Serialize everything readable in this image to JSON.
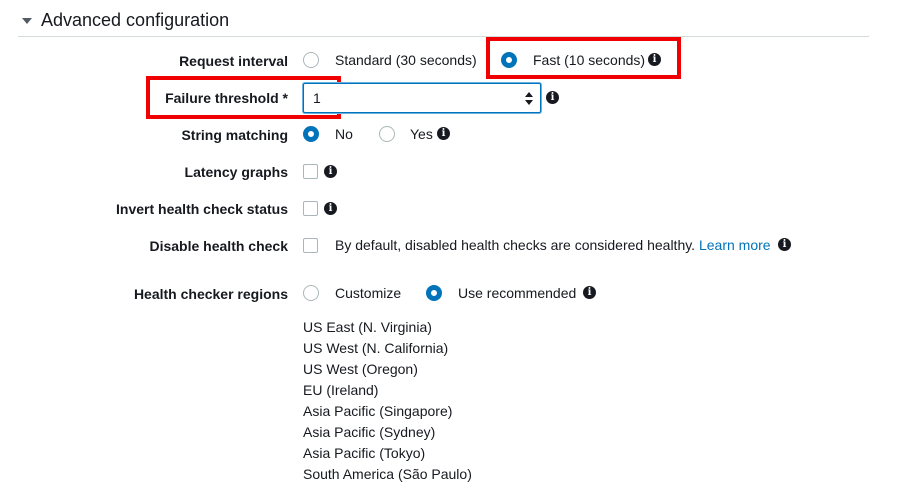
{
  "section": {
    "title": "Advanced configuration",
    "caret_icon": "caret-down-icon"
  },
  "request_interval": {
    "label": "Request interval",
    "options": [
      {
        "label": "Standard (30 seconds)",
        "checked": false
      },
      {
        "label": "Fast (10 seconds)",
        "checked": true
      }
    ]
  },
  "failure_threshold": {
    "label": "Failure threshold *",
    "value": "1"
  },
  "string_matching": {
    "label": "String matching",
    "options": [
      {
        "label": "No",
        "checked": true
      },
      {
        "label": "Yes",
        "checked": false
      }
    ]
  },
  "latency_graphs": {
    "label": "Latency graphs",
    "checked": false
  },
  "invert_status": {
    "label": "Invert health check status",
    "checked": false
  },
  "disable_check": {
    "label": "Disable health check",
    "checked": false,
    "description": "By default, disabled health checks are considered healthy.",
    "learn_more": "Learn more"
  },
  "regions": {
    "label": "Health checker regions",
    "options": [
      {
        "label": "Customize",
        "checked": false
      },
      {
        "label": "Use recommended",
        "checked": true
      }
    ],
    "list": [
      "US East (N. Virginia)",
      "US West (N. California)",
      "US West (Oregon)",
      "EU (Ireland)",
      "Asia Pacific (Singapore)",
      "Asia Pacific (Sydney)",
      "Asia Pacific (Tokyo)",
      "South America (São Paulo)"
    ]
  },
  "colors": {
    "accent": "#0073bb",
    "highlight": "#f00000",
    "text": "#16191f",
    "border": "#aab7b8"
  },
  "info_icon_glyph": "i"
}
